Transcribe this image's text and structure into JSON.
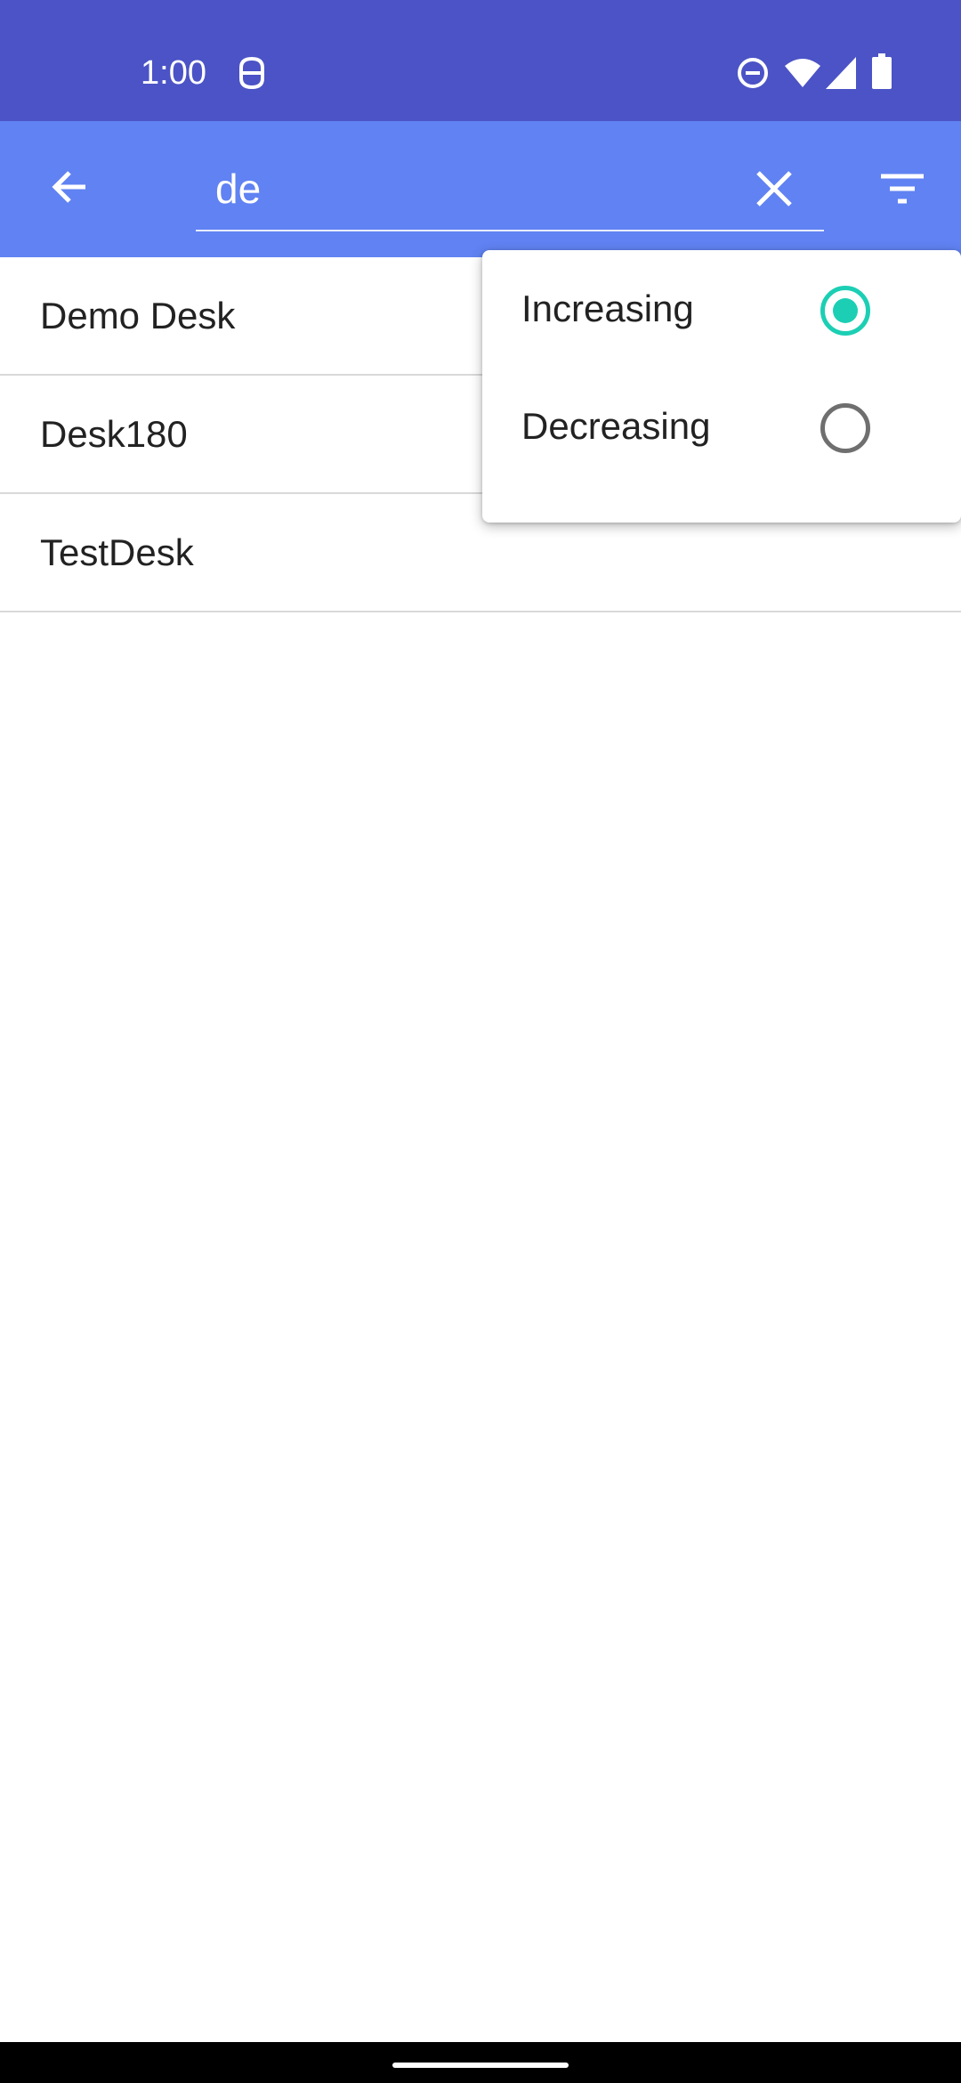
{
  "status_bar": {
    "time": "1:00",
    "icons": [
      "face-recognition-icon",
      "do-not-disturb-icon",
      "wifi-icon",
      "cellular-signal-icon",
      "battery-icon"
    ]
  },
  "app_bar": {
    "back_icon": "arrow-back-icon",
    "search_value": "de",
    "clear_icon": "close-icon",
    "filter_icon": "sort-filter-icon"
  },
  "results": [
    {
      "label": "Demo Desk"
    },
    {
      "label": "Desk180"
    },
    {
      "label": "TestDesk"
    }
  ],
  "sort_menu": {
    "options": [
      {
        "label": "Increasing",
        "selected": true
      },
      {
        "label": "Decreasing",
        "selected": false
      }
    ]
  },
  "colors": {
    "status_bar": "#4b53c6",
    "app_bar": "#6082f2",
    "radio_accent": "#1ccfb4"
  }
}
